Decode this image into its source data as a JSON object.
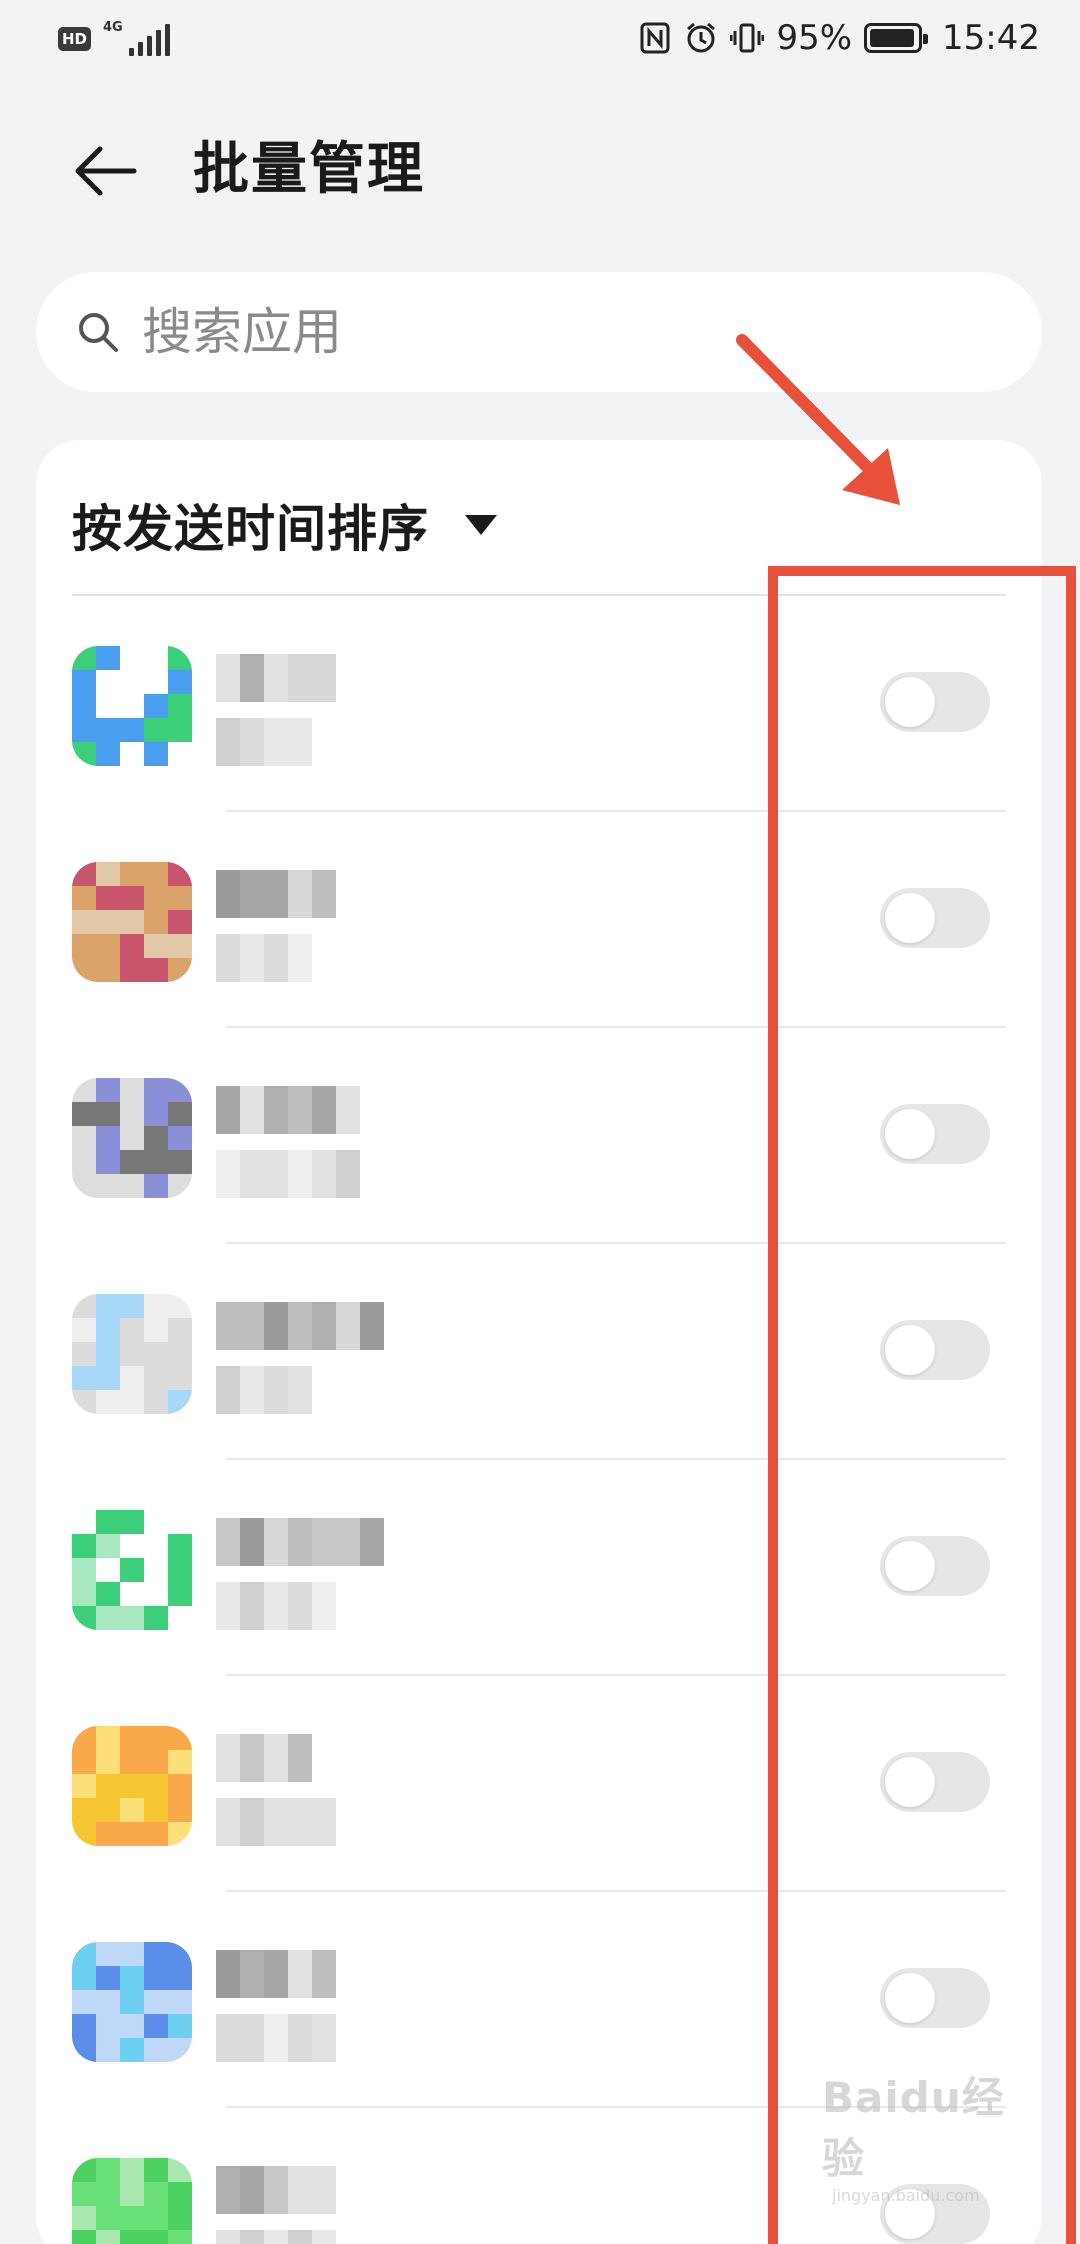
{
  "status_bar": {
    "hd_badge": "HD",
    "network": "4G",
    "battery": "95%",
    "battery_level": 0.95,
    "time": "15:42",
    "icons": [
      "nfc-icon",
      "alarm-icon",
      "vibrate-icon",
      "battery-icon"
    ]
  },
  "header": {
    "title": "批量管理",
    "back_icon": "back-arrow-icon"
  },
  "search": {
    "placeholder": "搜索应用",
    "icon": "search-icon"
  },
  "sort": {
    "label": "按发送时间排序",
    "icon": "caret-down-icon"
  },
  "apps": [
    {
      "enabled": false,
      "icon_colors": [
        "#3ccf7a",
        "#ffffff",
        "#4a9ef0"
      ]
    },
    {
      "enabled": false,
      "icon_colors": [
        "#c8556b",
        "#d9a36a",
        "#e0c8a8"
      ]
    },
    {
      "enabled": false,
      "icon_colors": [
        "#777777",
        "#8b8fd8",
        "#dddddd"
      ]
    },
    {
      "enabled": false,
      "icon_colors": [
        "#a8d8f8",
        "#eeeeee",
        "#dcdcdc"
      ]
    },
    {
      "enabled": false,
      "icon_colors": [
        "#3ccf7a",
        "#ffffff",
        "#a8e8c0"
      ]
    },
    {
      "enabled": false,
      "icon_colors": [
        "#f6c632",
        "#f9a84a",
        "#fbe07a"
      ]
    },
    {
      "enabled": false,
      "icon_colors": [
        "#6ed0f0",
        "#5a8ee8",
        "#c0d8f8"
      ]
    },
    {
      "enabled": false,
      "icon_colors": [
        "#4cd060",
        "#6ae07a",
        "#a8e8b0"
      ]
    }
  ],
  "annotation": {
    "color": "#e8503a"
  },
  "watermark": {
    "text": "Baidu经验",
    "sub": "jingyan.baidu.com"
  }
}
